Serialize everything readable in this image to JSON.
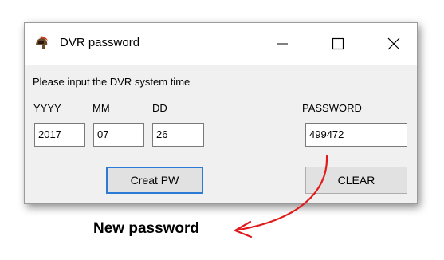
{
  "window": {
    "title": "DVR password",
    "icon": "spartan-helmet-icon"
  },
  "form": {
    "instruction": "Please input the DVR system time",
    "yyyy_label": "YYYY",
    "mm_label": "MM",
    "dd_label": "DD",
    "password_label": "PASSWORD",
    "yyyy_value": "2017",
    "mm_value": "07",
    "dd_value": "26",
    "password_value": "499472"
  },
  "buttons": {
    "creat_label": "Creat PW",
    "clear_label": "CLEAR"
  },
  "annotation": {
    "text": "New password",
    "arrow_color": "#e01a1a"
  },
  "colors": {
    "focus_border": "#2a7ad6",
    "dialog_bg": "#f0f0f0"
  }
}
